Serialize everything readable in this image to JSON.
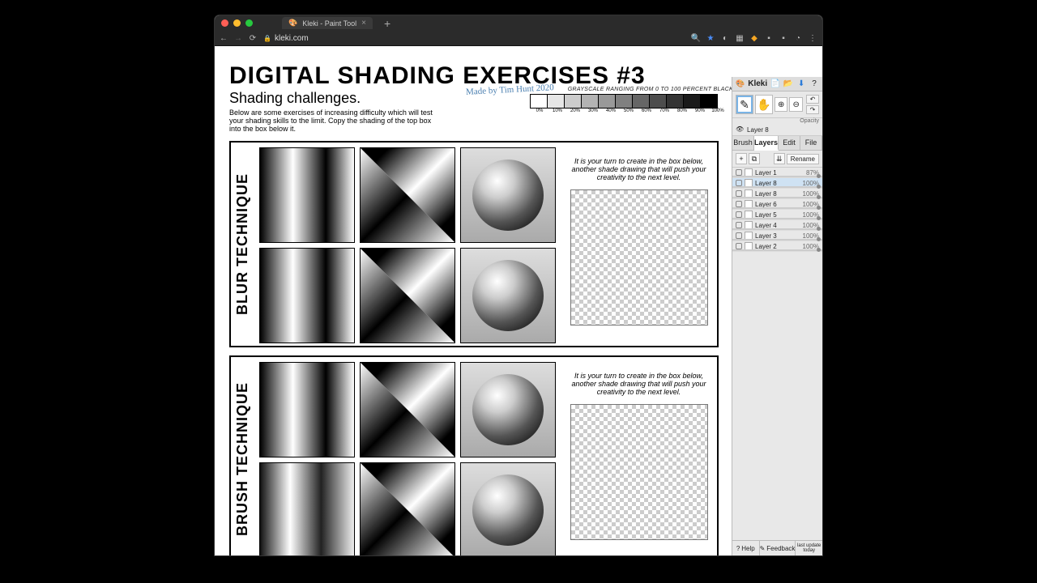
{
  "browser": {
    "tab_title": "Kleki - Paint Tool",
    "url": "kleki.com",
    "nav": {
      "back": "←",
      "forward": "→",
      "reload": "⟳"
    },
    "toolbar_icons": [
      "search",
      "star",
      "ext1",
      "ext2",
      "ext3",
      "ext4",
      "ext5",
      "profile",
      "menu"
    ]
  },
  "worksheet": {
    "title": "DIGITAL SHADING EXERCISES #3",
    "subtitle": "Shading challenges.",
    "credit": "Made by Tim Hunt 2020",
    "intro": "Below are some exercises of increasing difficulty which will test your shading skills to the limit. Copy the shading of the top box into the box below it.",
    "scale_caption": "GRAYSCALE RANGING FROM 0 TO 100 PERCENT BLACK",
    "scale_labels": [
      "0%",
      "10%",
      "20%",
      "30%",
      "40%",
      "50%",
      "60%",
      "70%",
      "80%",
      "90%",
      "100%"
    ],
    "exercises": [
      {
        "label": "BLUR TECHNIQUE",
        "prompt": "It is your turn to create in the box below, another shade drawing that will push your creativity to the next level."
      },
      {
        "label": "BRUSH TECHNIQUE",
        "prompt": "It is your turn to create in the box below, another shade drawing that will push your creativity to the next level."
      }
    ]
  },
  "panel": {
    "brand": "Kleki",
    "top_icons": [
      "new",
      "save",
      "import",
      "help"
    ],
    "tools": [
      "brush",
      "hand",
      "zoom-in",
      "zoom-out"
    ],
    "small_tools": [
      "undo",
      "redo"
    ],
    "opacity_label": "Opacity",
    "current_layer": "Layer 8",
    "tabs": [
      "Brush",
      "Layers",
      "Edit",
      "File"
    ],
    "active_tab": "Layers",
    "layer_buttons": [
      "add",
      "dup",
      "merge",
      "del"
    ],
    "rename_label": "Rename",
    "layers": [
      {
        "name": "Layer 1",
        "opacity": "87%",
        "selected": false
      },
      {
        "name": "Layer 8",
        "opacity": "100%",
        "selected": true
      },
      {
        "name": "Layer 8",
        "opacity": "100%",
        "selected": false
      },
      {
        "name": "Layer 6",
        "opacity": "100%",
        "selected": false
      },
      {
        "name": "Layer 5",
        "opacity": "100%",
        "selected": false
      },
      {
        "name": "Layer 4",
        "opacity": "100%",
        "selected": false
      },
      {
        "name": "Layer 3",
        "opacity": "100%",
        "selected": false
      },
      {
        "name": "Layer 2",
        "opacity": "100%",
        "selected": false
      }
    ],
    "footer": {
      "help": "Help",
      "feedback": "Feedback",
      "update": "last update today"
    }
  }
}
